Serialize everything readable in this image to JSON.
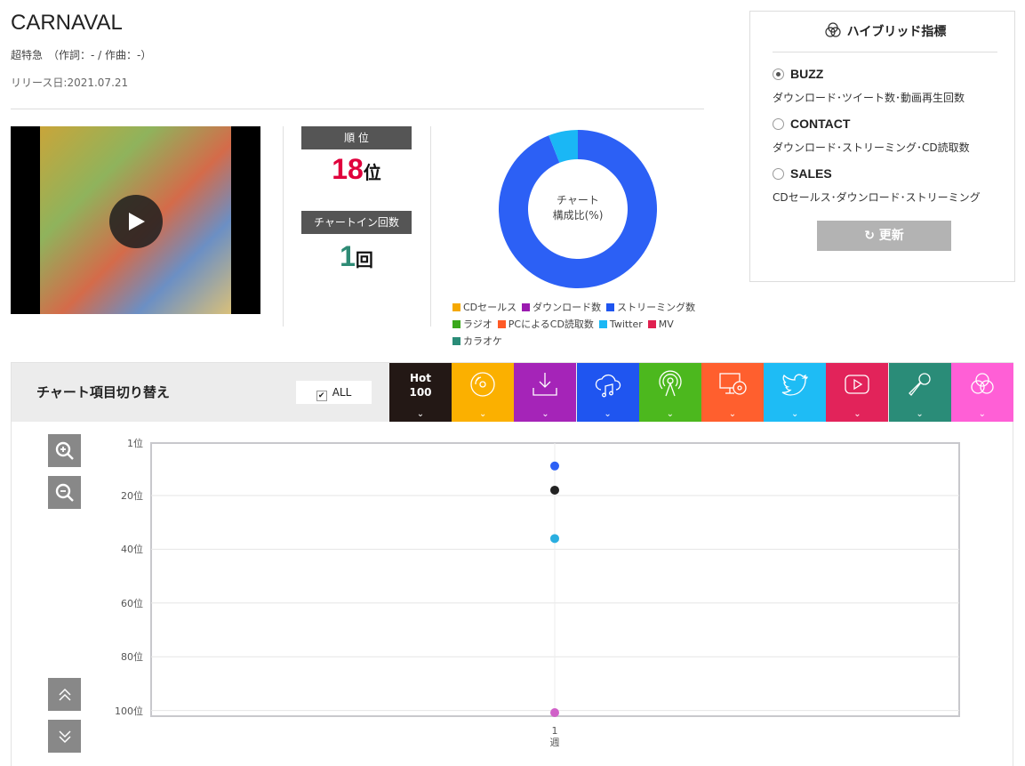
{
  "song": {
    "title": "CARNAVAL",
    "artist_line": "超特急　（作詞：- / 作曲：-）",
    "release": "リリース日:2021.07.21"
  },
  "stats": {
    "rank_label": "順 位",
    "rank_value": "18",
    "rank_unit": "位",
    "chartin_label": "チャートイン回数",
    "chartin_value": "1",
    "chartin_unit": "回"
  },
  "donut": {
    "center_line1": "チャート",
    "center_line2": "構成比(%)",
    "legend": [
      {
        "label": "CDセールス",
        "color": "#f5a800"
      },
      {
        "label": "ダウンロード数",
        "color": "#9b1bb0"
      },
      {
        "label": "ストリーミング数",
        "color": "#1f55f0"
      },
      {
        "label": "ラジオ",
        "color": "#3aa81c"
      },
      {
        "label": "PCによるCD読取数",
        "color": "#ff5a26"
      },
      {
        "label": "Twitter",
        "color": "#1ab7f5"
      },
      {
        "label": "MV",
        "color": "#e0204f"
      },
      {
        "label": "カラオケ",
        "color": "#2a8c78"
      }
    ]
  },
  "chart_data": [
    {
      "type": "pie",
      "title": "",
      "slices": [
        {
          "label": "ストリーミング数",
          "value": 94,
          "color": "#2c60f5"
        },
        {
          "label": "Twitter",
          "value": 6,
          "color": "#1ab7f5"
        }
      ]
    },
    {
      "type": "scatter",
      "x_categories": [
        "1\n週"
      ],
      "ylim": [
        1,
        100
      ],
      "y_inverted": true,
      "y_ticks": [
        "1位",
        "20位",
        "40位",
        "60位",
        "80位",
        "100位"
      ],
      "series": [
        {
          "key": "streaming",
          "color": "#2c60f5",
          "values": [
            9
          ]
        },
        {
          "key": "hot100",
          "color": "#222222",
          "values": [
            18
          ]
        },
        {
          "key": "twitter",
          "color": "#2aaee0",
          "values": [
            36
          ]
        },
        {
          "key": "hybrid",
          "color": "#d060c8",
          "values": [
            101
          ]
        }
      ]
    }
  ],
  "hybrid": {
    "title": "ハイブリッド指標",
    "options": [
      {
        "label": "BUZZ",
        "desc": "ダウンロード･ツイート数･動画再生回数",
        "selected": true
      },
      {
        "label": "CONTACT",
        "desc": "ダウンロード･ストリーミング･CD読取数",
        "selected": false
      },
      {
        "label": "SALES",
        "desc": "CDセールス･ダウンロード･ストリーミング",
        "selected": false
      }
    ],
    "refresh": "更新"
  },
  "switcher": {
    "title": "チャート項目切り替え",
    "all": "ALL",
    "tabs": [
      {
        "name": "hot100",
        "label1": "Hot",
        "label2": "100",
        "color": "#231815"
      },
      {
        "name": "cd-sales",
        "icon": "disc-icon",
        "color": "#fbb000"
      },
      {
        "name": "download",
        "icon": "download-icon",
        "color": "#a524b8"
      },
      {
        "name": "streaming",
        "icon": "cloud-music-icon",
        "color": "#1f55f0"
      },
      {
        "name": "radio",
        "icon": "antenna-icon",
        "color": "#4cb81e"
      },
      {
        "name": "pc-cd",
        "icon": "pc-disc-icon",
        "color": "#ff5f2e"
      },
      {
        "name": "twitter",
        "icon": "twitter-icon",
        "color": "#1ebcf5"
      },
      {
        "name": "mv",
        "icon": "video-play-icon",
        "color": "#e2235a"
      },
      {
        "name": "karaoke",
        "icon": "microphone-icon",
        "color": "#2a8c78"
      },
      {
        "name": "hybrid",
        "icon": "venn-icon",
        "color": "#ff5fd6"
      }
    ]
  },
  "xaxis": {
    "tick_num": "1",
    "tick_unit": "週"
  }
}
